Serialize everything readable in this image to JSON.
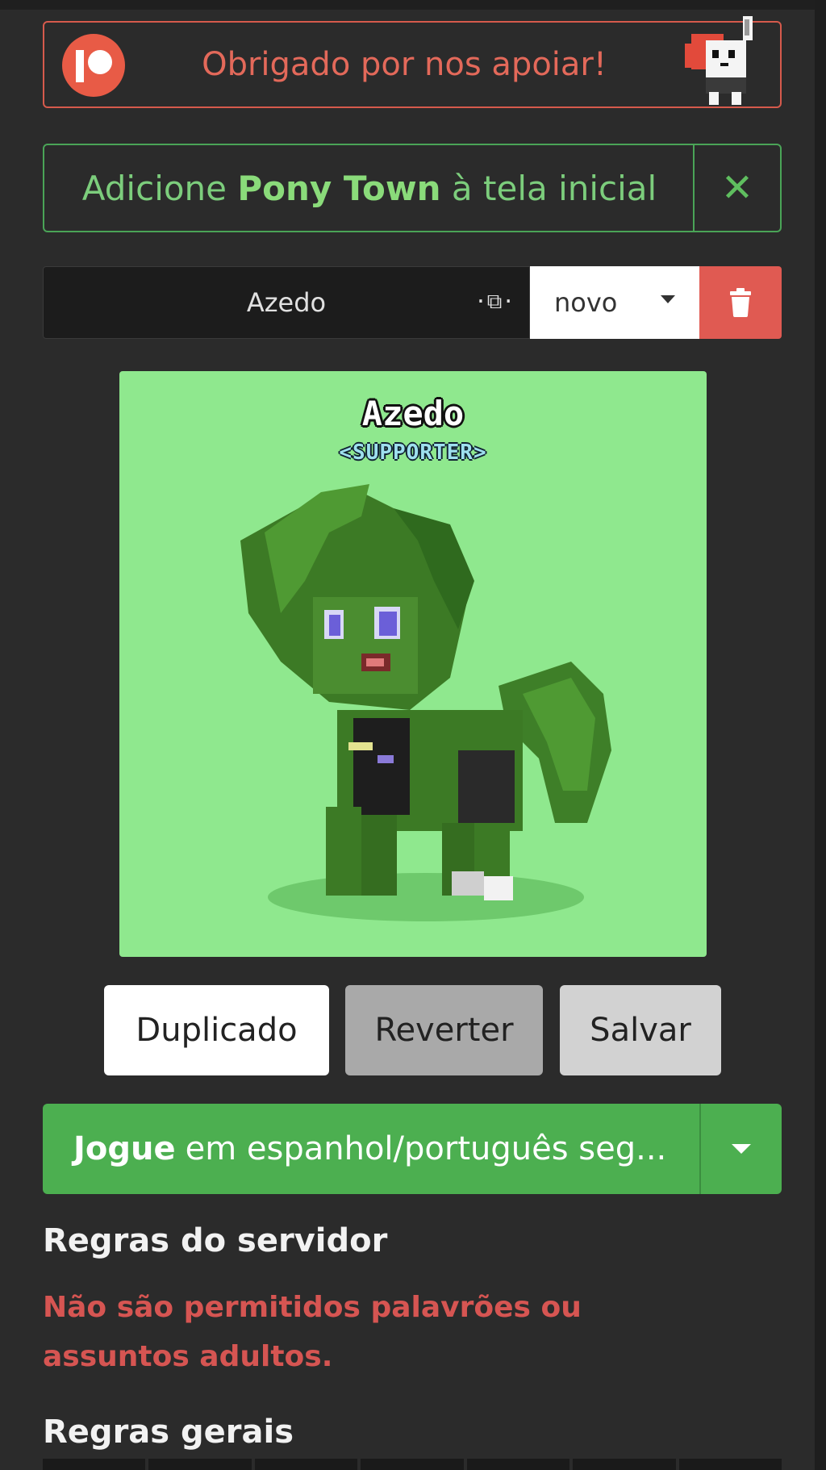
{
  "patreon_banner": {
    "text": "Obrigado por nos apoiar!"
  },
  "add_to_home": {
    "prefix": "Adicione",
    "app_name": "Pony Town",
    "suffix": "à tela inicial"
  },
  "character": {
    "name": "Azedo",
    "select_value": "novo"
  },
  "preview": {
    "name": "Azedo",
    "tag": "<SUPPORTER>"
  },
  "buttons": {
    "duplicate": "Duplicado",
    "revert": "Reverter",
    "save": "Salvar"
  },
  "play": {
    "bold": "Jogue",
    "rest": "em espanhol/português seg..."
  },
  "server_rules": {
    "heading": "Regras do servidor",
    "text": "Não são permitidos palavrões ou assuntos adultos."
  },
  "general_rules": {
    "heading": "Regras gerais"
  },
  "colors": {
    "accent_green": "#4caf50",
    "danger_red": "#e05a52",
    "patreon_red": "#e85b46",
    "preview_bg": "#8fe88e"
  }
}
